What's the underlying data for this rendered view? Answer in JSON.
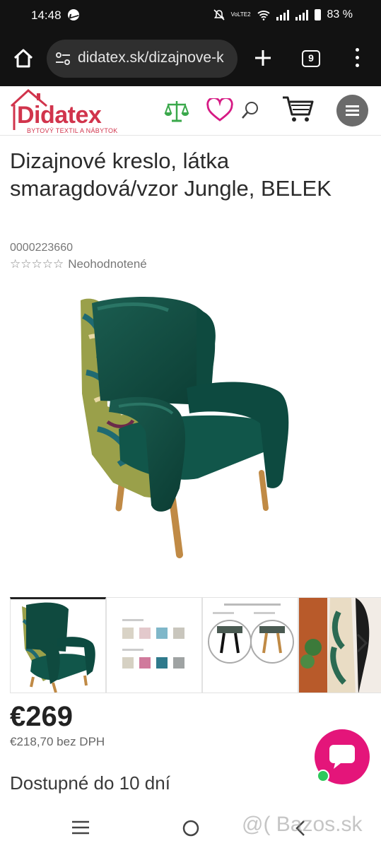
{
  "status_bar": {
    "time": "14:48",
    "network_label": "VoLTE2",
    "battery": "83 %"
  },
  "browser": {
    "url": "didatex.sk/dizajnove-k",
    "tab_count": "9"
  },
  "site": {
    "logo_text": "Didatex",
    "logo_tagline": "BYTOVÝ TEXTIL A NÁBYTOK",
    "brand_color": "#d1344c"
  },
  "product": {
    "title": "Dizajnové kreslo, látka smaragdová/vzor Jungle, BELEK",
    "sku": "0000223660",
    "stars": "☆☆☆☆☆",
    "rating_label": "Neohodnotené",
    "price": "€269",
    "price_without_vat": "€218,70 bez DPH",
    "availability": "Dostupné do 10 dní",
    "colors": {
      "velvet": "#0f4a3f",
      "accent": "#e4157a"
    }
  },
  "watermark": "@( Bazos.sk"
}
